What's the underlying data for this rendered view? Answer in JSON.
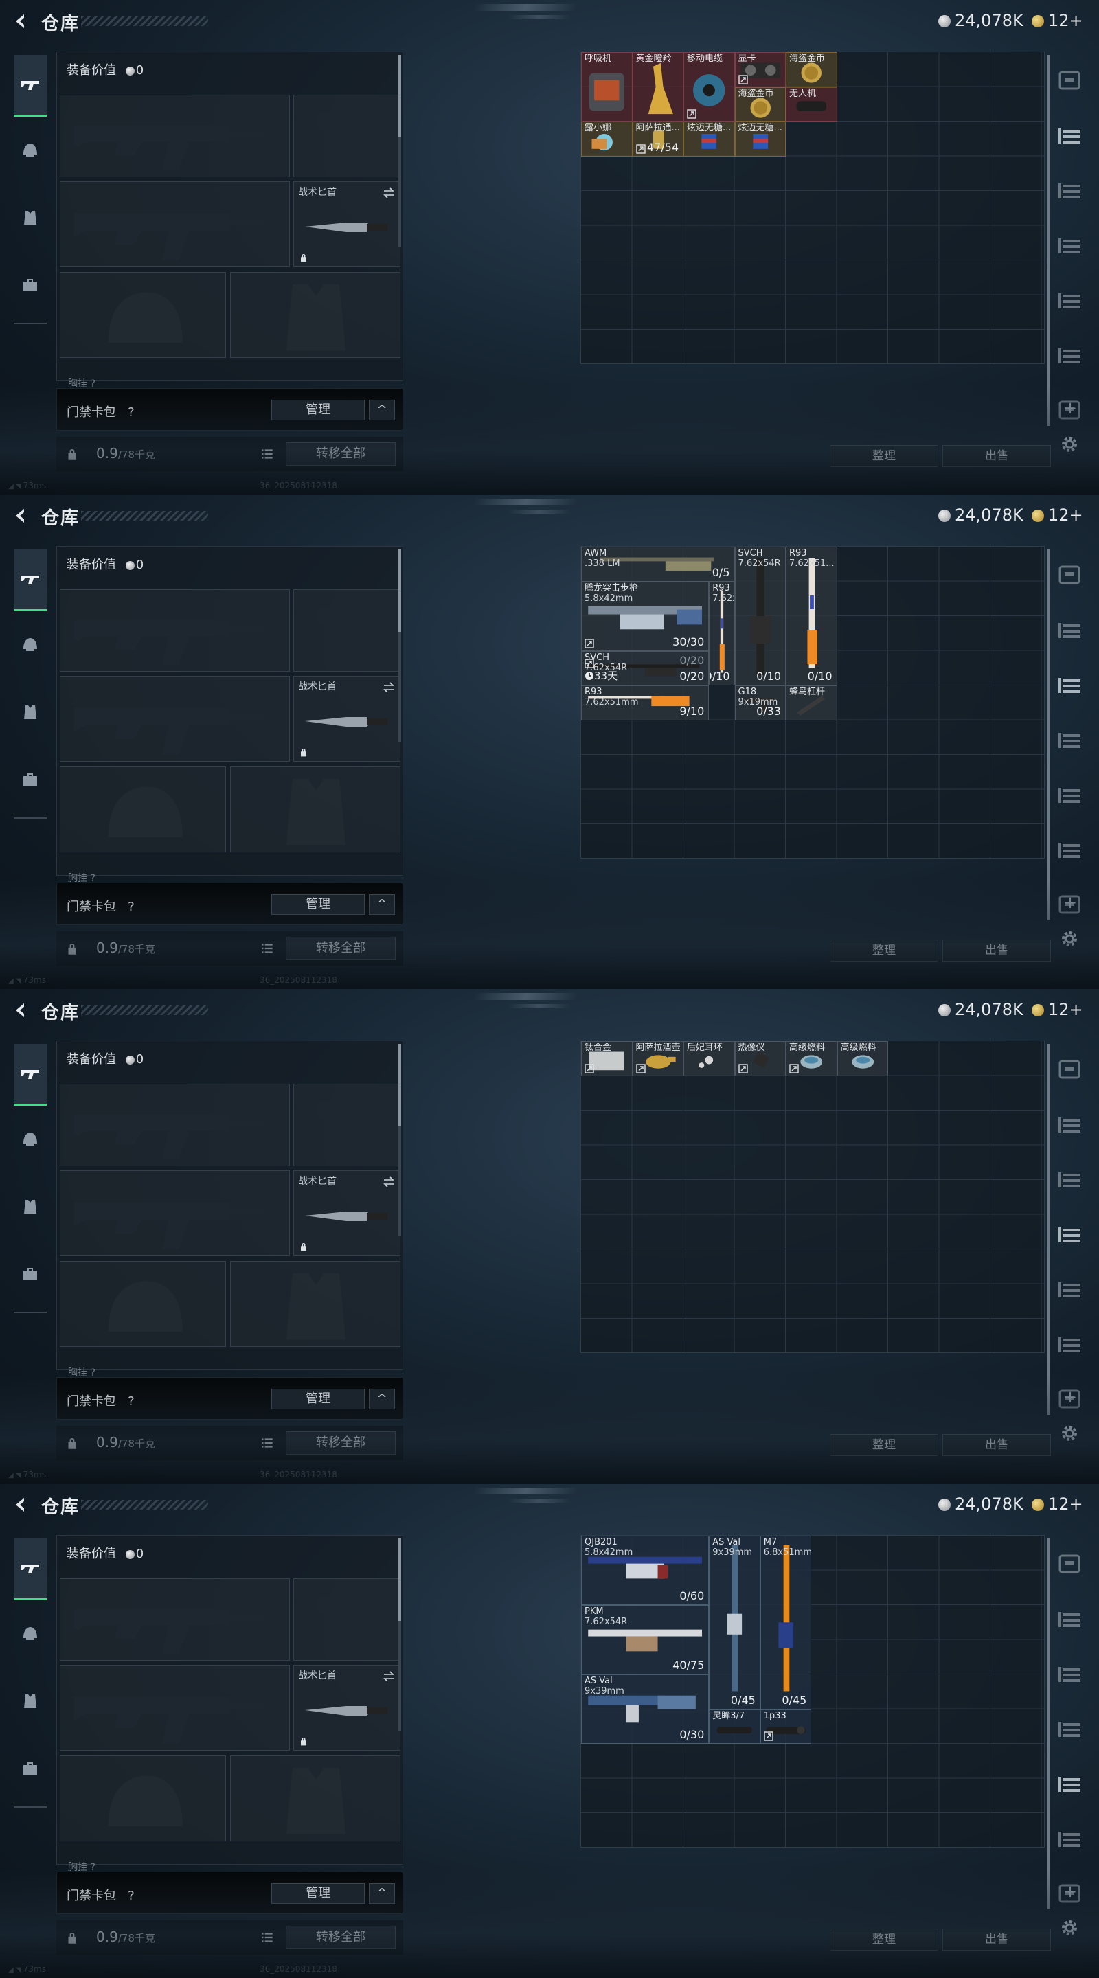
{
  "app": {
    "title": "仓库",
    "silver": "24,078K",
    "gold": "12+"
  },
  "equipment": {
    "value_label": "装备价值",
    "value": "0",
    "knife_label": "战术匕首",
    "cut_label": "胸挂 ?"
  },
  "keycard": {
    "label": "门禁卡包",
    "help": "?",
    "manage": "管理",
    "toggle": "^"
  },
  "capacity": {
    "value": "0.9",
    "unit": "/78千克",
    "transfer_all": "转移全部"
  },
  "status": {
    "ping": "73ms",
    "build": "36_202508112318"
  },
  "actions": {
    "sort": "整理",
    "sell": "出售"
  },
  "colors": {
    "accent": "#3fe08a",
    "rarity_red": "#6e282d",
    "rarity_gold": "#69522a",
    "rarity_blue": "#1e2d3e"
  },
  "panels": [
    {
      "active_tab": 1,
      "items": [
        {
          "name": "呼吸机",
          "sub": "",
          "count": ""
        },
        {
          "name": "黄金瞪羚",
          "sub": "",
          "count": ""
        },
        {
          "name": "移动电缆",
          "sub": "",
          "count": ""
        },
        {
          "name": "显卡",
          "sub": "",
          "count": ""
        },
        {
          "name": "海盗金币",
          "sub": "",
          "count": ""
        },
        {
          "name": "海盗金币",
          "sub": "",
          "count": ""
        },
        {
          "name": "无人机",
          "sub": "",
          "count": ""
        },
        {
          "name": "露小娜",
          "sub": "",
          "count": ""
        },
        {
          "name": "阿萨拉通...",
          "sub": "",
          "count": "47/54"
        },
        {
          "name": "炫迈无糖...",
          "sub": "",
          "count": ""
        },
        {
          "name": "炫迈无糖...",
          "sub": "",
          "count": ""
        }
      ]
    },
    {
      "active_tab": 2,
      "items": [
        {
          "name": "AWM",
          "sub": ".338 LM",
          "count": "0/5"
        },
        {
          "name": "SVCH",
          "sub": "7.62x54R",
          "count": "0/10"
        },
        {
          "name": "R93",
          "sub": "7.62x51...",
          "count": "0/10"
        },
        {
          "name": "腾龙突击步枪",
          "sub": "5.8x42mm",
          "count": "30/30"
        },
        {
          "name": "R93",
          "sub": "7.62x51...",
          "count": "9/10"
        },
        {
          "name": "SVCH",
          "sub": "7.62x54R",
          "count": "0/20",
          "count2": "0/20",
          "time": "33天"
        },
        {
          "name": "R93",
          "sub": "7.62x51mm",
          "count": "9/10"
        },
        {
          "name": "G18",
          "sub": "9x19mm",
          "count": "0/33"
        },
        {
          "name": "蜂鸟杠杆",
          "sub": "",
          "count": ""
        }
      ]
    },
    {
      "active_tab": 3,
      "items": [
        {
          "name": "钛合金",
          "sub": "",
          "count": ""
        },
        {
          "name": "阿萨拉酒壶",
          "sub": "",
          "count": ""
        },
        {
          "name": "后妃耳环",
          "sub": "",
          "count": ""
        },
        {
          "name": "热像仪",
          "sub": "",
          "count": ""
        },
        {
          "name": "高级燃料",
          "sub": "",
          "count": ""
        },
        {
          "name": "高级燃料",
          "sub": "",
          "count": ""
        }
      ]
    },
    {
      "active_tab": 4,
      "items": [
        {
          "name": "QJB201",
          "sub": "5.8x42mm",
          "count": "0/60"
        },
        {
          "name": "AS Val",
          "sub": "9x39mm",
          "count": "0/45"
        },
        {
          "name": "M7",
          "sub": "6.8x51mm",
          "count": "0/45"
        },
        {
          "name": "PKM",
          "sub": "7.62x54R",
          "count": "40/75"
        },
        {
          "name": "AS Val",
          "sub": "9x39mm",
          "count": "0/30"
        },
        {
          "name": "灵眸3/7",
          "sub": "",
          "count": ""
        },
        {
          "name": "1p33",
          "sub": "",
          "count": ""
        }
      ]
    }
  ]
}
